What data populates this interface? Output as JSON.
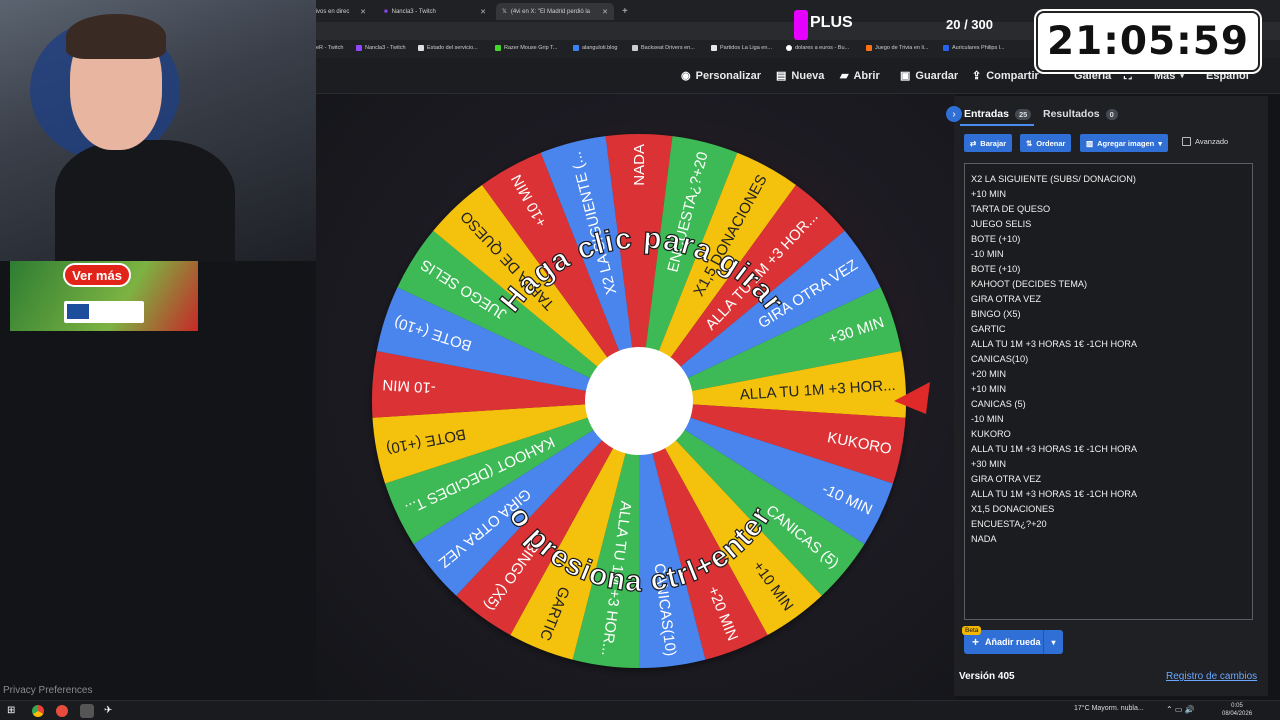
{
  "browser": {
    "tabs": [
      {
        "label": "rtivos en direc",
        "color": "#ffffff"
      },
      {
        "label": "Nancla3 - Twitch",
        "color": "#9146ff"
      },
      {
        "label": "(4vi en X: \"El Madrid perdió la",
        "color": "#ffffff"
      }
    ],
    "bookmarks": [
      "eR - Twitch",
      "Nancla3 - Twitch",
      "Estado del servicio...",
      "Razer Mouse Grip T...",
      "alanguloti.blog",
      "Backseat Drivers en...",
      "Partidos La Liga en...",
      "dolares a euros - Bu...",
      "Juego de Trivia en li...",
      "Auriculares Philips l..."
    ]
  },
  "toolbar": {
    "personalizar": "Personalizar",
    "nueva": "Nueva",
    "abrir": "Abrir",
    "guardar": "Guardar",
    "compartir": "Compartir",
    "galeria": "Galería",
    "mas": "Más",
    "idioma": "Español"
  },
  "overlay": {
    "plus_label": "PLUS",
    "counter": "20 / 300",
    "timer": "21:05:59"
  },
  "wheel": {
    "prompt_top": "Haga clic para girar",
    "prompt_bottom": "o presiona ctrl+enter",
    "slices": [
      {
        "label": "NADA",
        "color": "#db3236"
      },
      {
        "label": "ENCUESTA¿?+20",
        "color": "#3cba54"
      },
      {
        "label": "X1,5 DONACIONES",
        "color": "#f4c20d"
      },
      {
        "label": "ALLA TU 1M +3 HOR...",
        "color": "#db3236"
      },
      {
        "label": "GIRA OTRA VEZ",
        "color": "#4885ed"
      },
      {
        "label": "+30 MIN",
        "color": "#3cba54"
      },
      {
        "label": "ALLA TU 1M +3 HOR...",
        "color": "#f4c20d"
      },
      {
        "label": "KUKORO",
        "color": "#db3236"
      },
      {
        "label": "-10 MIN",
        "color": "#4885ed"
      },
      {
        "label": "CANICAS (5)",
        "color": "#3cba54"
      },
      {
        "label": "+10 MIN",
        "color": "#f4c20d"
      },
      {
        "label": "+20 MIN",
        "color": "#db3236"
      },
      {
        "label": "CANICAS(10)",
        "color": "#4885ed"
      },
      {
        "label": "ALLA TU 1M +3 HOR...",
        "color": "#3cba54"
      },
      {
        "label": "GARTIC",
        "color": "#f4c20d"
      },
      {
        "label": "BINGO (X5)",
        "color": "#db3236"
      },
      {
        "label": "GIRA OTRA VEZ",
        "color": "#4885ed"
      },
      {
        "label": "KAHOOT (DECIDES T...",
        "color": "#3cba54"
      },
      {
        "label": "BOTE (+10)",
        "color": "#f4c20d"
      },
      {
        "label": "-10 MIN",
        "color": "#db3236"
      },
      {
        "label": "BOTE (+10)",
        "color": "#4885ed"
      },
      {
        "label": "JUEGO SELIS",
        "color": "#3cba54"
      },
      {
        "label": "TARTA DE QUESO",
        "color": "#f4c20d"
      },
      {
        "label": "+10 MIN",
        "color": "#db3236"
      },
      {
        "label": "X2 LA SIGUIENTE (...",
        "color": "#4885ed"
      }
    ]
  },
  "panel": {
    "tab_entries": "Entradas",
    "entries_count": "25",
    "tab_results": "Resultados",
    "results_count": "0",
    "btn_shuffle": "Barajar",
    "btn_sort": "Ordenar",
    "btn_add_image": "Agregar imagen",
    "advanced": "Avanzado",
    "entries": [
      "X2 LA SIGUIENTE (SUBS/ DONACION)",
      "+10 MIN",
      "TARTA DE QUESO",
      "JUEGO SELIS",
      "BOTE (+10)",
      "-10 MIN",
      "BOTE (+10)",
      "KAHOOT (DECIDES TEMA)",
      "GIRA OTRA VEZ",
      "BINGO (X5)",
      "GARTIC",
      "ALLA TU 1M +3 HORAS 1€ -1CH HORA",
      "CANICAS(10)",
      "+20 MIN",
      "+10 MIN",
      "CANICAS (5)",
      "-10 MIN",
      "KUKORO",
      "ALLA TU 1M +3 HORAS 1€ -1CH HORA",
      "+30 MIN",
      "GIRA OTRA VEZ",
      "ALLA TU 1M +3 HORAS 1€ -1CH HORA",
      "X1,5 DONACIONES",
      "ENCUESTA¿?+20",
      "NADA"
    ],
    "beta": "Beta",
    "add_wheel": "Añadir rueda",
    "version": "Versión 405",
    "changelog": "Registro de cambios"
  },
  "side": {
    "ad_button": "Ver más",
    "privacy": "Privacy Preferences"
  },
  "taskbar": {
    "weather": "17°C  Mayorm. nubla...",
    "time": "0:05",
    "date": "08/04/2026"
  }
}
